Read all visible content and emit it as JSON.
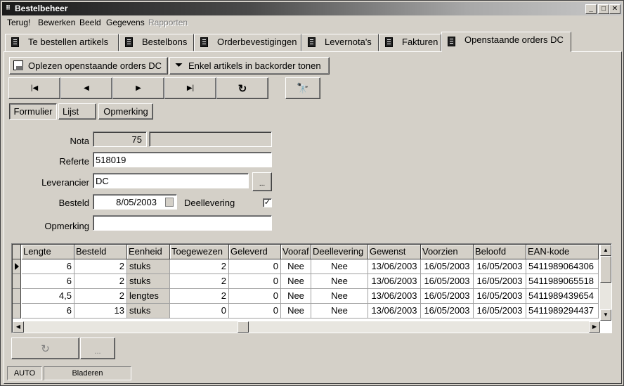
{
  "window": {
    "title": "Bestelbeheer"
  },
  "menu": [
    {
      "label": "Terug!",
      "enabled": true
    },
    {
      "label": "Bewerken",
      "enabled": true
    },
    {
      "label": "Beeld",
      "enabled": true
    },
    {
      "label": "Gegevens",
      "enabled": true
    },
    {
      "label": "Rapporten",
      "enabled": false
    }
  ],
  "tabs": [
    {
      "label": "Te bestellen artikels"
    },
    {
      "label": "Bestelbons"
    },
    {
      "label": "Orderbevestigingen"
    },
    {
      "label": "Levernota's"
    },
    {
      "label": "Fakturen"
    },
    {
      "label": "Openstaande orders DC",
      "active": true
    }
  ],
  "toolbar": {
    "load_label": "Oplezen openstaande orders DC",
    "filter_label": "Enkel artikels in backorder tonen"
  },
  "nav": {
    "first": "|◀",
    "prev": "◀",
    "next": "▶",
    "last": "▶|",
    "refresh": "↻",
    "find": "🔭"
  },
  "views": {
    "form": "Formulier",
    "list": "Lijst",
    "remark": "Opmerking"
  },
  "form": {
    "nota_label": "Nota",
    "nota_value": "75",
    "nota_extra": "",
    "referte_label": "Referte",
    "referte_value": "518019",
    "leverancier_label": "Leverancier",
    "leverancier_value": "DC",
    "leverancier_browse": "...",
    "besteld_label": "Besteld",
    "besteld_value": "8/05/2003",
    "deellevering_label": "Deellevering",
    "deellevering_checked": "✓",
    "opmerking_label": "Opmerking",
    "opmerking_value": ""
  },
  "grid": {
    "columns": [
      "Lengte",
      "Besteld",
      "Eenheid",
      "Toegewezen",
      "Geleverd",
      "Vooraf",
      "Deellevering",
      "Gewenst",
      "Voorzien",
      "Beloofd",
      "EAN-kode"
    ],
    "rows": [
      [
        "6",
        "2",
        "stuks",
        "2",
        "0",
        "Nee",
        "Nee",
        "13/06/2003",
        "16/05/2003",
        "16/05/2003",
        "5411989064306"
      ],
      [
        "6",
        "2",
        "stuks",
        "2",
        "0",
        "Nee",
        "Nee",
        "13/06/2003",
        "16/05/2003",
        "16/05/2003",
        "5411989065518"
      ],
      [
        "4,5",
        "2",
        "lengtes",
        "2",
        "0",
        "Nee",
        "Nee",
        "13/06/2003",
        "16/05/2003",
        "16/05/2003",
        "5411989439654"
      ],
      [
        "6",
        "13",
        "stuks",
        "0",
        "0",
        "Nee",
        "Nee",
        "13/06/2003",
        "16/05/2003",
        "16/05/2003",
        "5411989294437"
      ]
    ]
  },
  "bottom_buttons": {
    "refresh_icon": "↻",
    "more": "..."
  },
  "status": {
    "mode": "AUTO",
    "state": "Bladeren"
  }
}
